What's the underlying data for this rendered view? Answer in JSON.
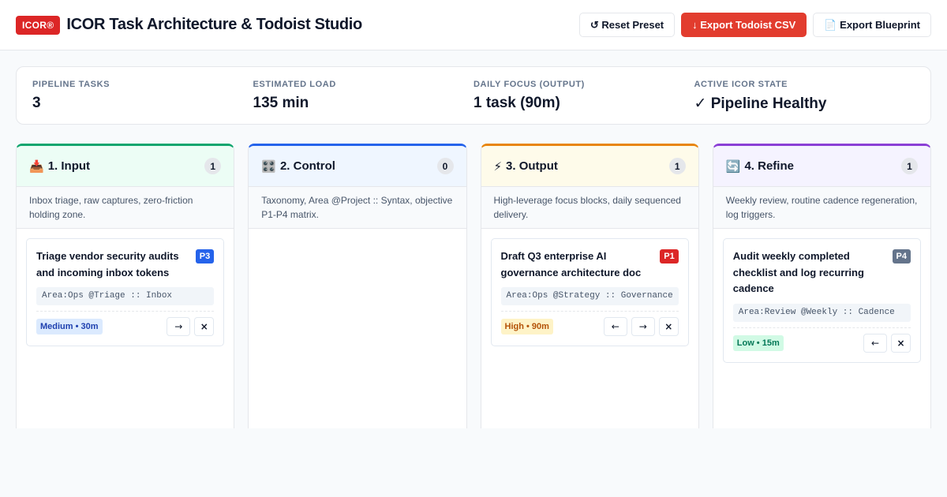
{
  "header": {
    "logo": "ICOR®",
    "title": "ICOR Task Architecture & Todoist Studio",
    "buttons": {
      "reset": "↺ Reset Preset",
      "export_csv": "↓ Export Todoist CSV",
      "export_blueprint": "📄 Export Blueprint"
    }
  },
  "stats": [
    {
      "label": "Pipeline Tasks",
      "value": "3"
    },
    {
      "label": "Estimated Load",
      "value": "135 min"
    },
    {
      "label": "Daily Focus (Output)",
      "value": "1 task (90m)"
    },
    {
      "label": "Active ICOR State",
      "value": "✓ Pipeline Healthy"
    }
  ],
  "columns": [
    {
      "icon": "📥",
      "title": "1. Input",
      "count": "1",
      "description": "Inbox triage, raw captures, zero-friction holding zone.",
      "cards": [
        {
          "title": "Triage vendor security audits and incoming inbox tokens",
          "priority": "P3",
          "syntax": "Area:Ops @Triage :: Inbox",
          "effort": "Medium • 30m",
          "move_right": "→",
          "remove": "×"
        }
      ]
    },
    {
      "icon": "🎛️",
      "title": "2. Control",
      "count": "0",
      "description": "Taxonomy, Area @Project :: Syntax, objective P1-P4 matrix.",
      "cards": []
    },
    {
      "icon": "⚡",
      "title": "3. Output",
      "count": "1",
      "description": "High-leverage focus blocks, daily sequenced delivery.",
      "cards": [
        {
          "title": "Draft Q3 enterprise AI governance architecture doc",
          "priority": "P1",
          "syntax": "Area:Ops @Strategy :: Governance",
          "effort": "High • 90m",
          "move_left": "←",
          "move_right": "→",
          "remove": "×"
        }
      ]
    },
    {
      "icon": "🔄",
      "title": "4. Refine",
      "count": "1",
      "description": "Weekly review, routine cadence regeneration, log triggers.",
      "cards": [
        {
          "title": "Audit weekly completed checklist and log recurring cadence",
          "priority": "P4",
          "syntax": "Area:Review @Weekly :: Cadence",
          "effort": "Low • 15m",
          "move_left": "←",
          "remove": "×"
        }
      ]
    }
  ]
}
